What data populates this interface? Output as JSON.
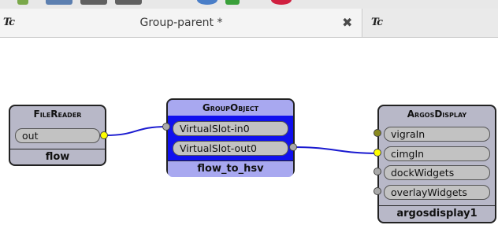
{
  "tab_active": {
    "icon": "Tc",
    "title": "Group-parent *",
    "close_icon": "close-icon"
  },
  "tab_inactive": {
    "icon": "Tc"
  },
  "nodes": {
    "filereader": {
      "header": "FileReader",
      "ports": [
        "out"
      ],
      "footer": "flow"
    },
    "groupobject": {
      "header": "GroupObject",
      "ports": [
        "VirtualSlot-in0",
        "VirtualSlot-out0"
      ],
      "footer": "flow_to_hsv"
    },
    "argosdisplay": {
      "header": "ArgosDisplay",
      "ports": [
        "vigraIn",
        "cimgIn",
        "dockWidgets",
        "overlayWidgets"
      ],
      "footer": "argosdisplay1"
    }
  },
  "colors": {
    "node_gray": "#b8b8c8",
    "node_gray_border": "#222222",
    "group_blue": "#1010ee",
    "group_header": "#a8a8f0",
    "wire": "#1a1ad0",
    "dot_active": "#ffff00",
    "dot_olive": "#8a8a20",
    "dot_idle": "#a8a8a8"
  }
}
